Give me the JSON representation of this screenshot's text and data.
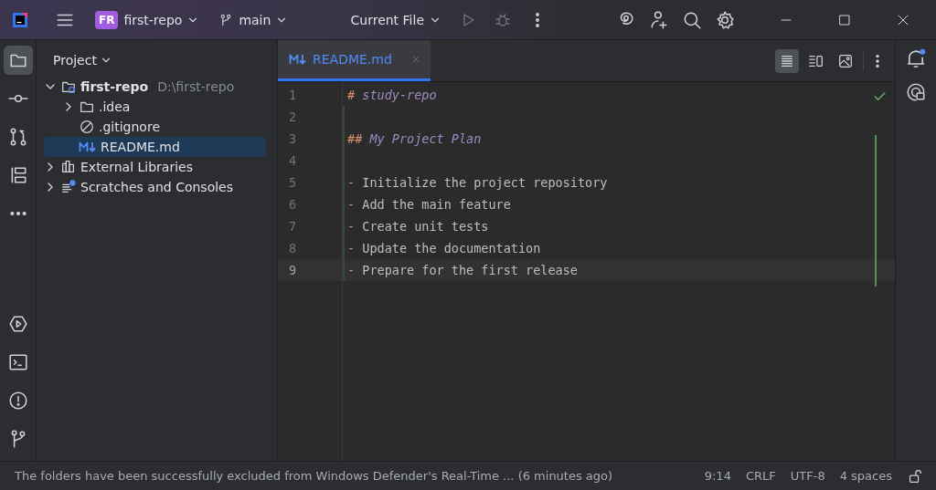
{
  "title_bar": {
    "project_badge": "FR",
    "project": "first-repo",
    "branch": "main",
    "run_config": "Current File"
  },
  "project_panel": {
    "title": "Project",
    "tree": [
      {
        "label": "first-repo",
        "hint": "D:\\first-repo",
        "kind": "module",
        "bold": true,
        "expanded": true,
        "selected": false,
        "children": [
          {
            "label": ".idea",
            "kind": "folder",
            "expanded": false,
            "selected": false
          },
          {
            "label": ".gitignore",
            "kind": "ignore",
            "selected": false
          },
          {
            "label": "README.md",
            "kind": "markdown",
            "selected": true
          }
        ]
      },
      {
        "label": "External Libraries",
        "kind": "library",
        "expanded": false,
        "selected": false
      },
      {
        "label": "Scratches and Consoles",
        "kind": "scratches",
        "expanded": false,
        "selected": false
      }
    ]
  },
  "editor": {
    "tabs": [
      {
        "label": "README.md",
        "selected": true
      }
    ],
    "lines": [
      {
        "number": "1",
        "kind": "heading",
        "marker": "#",
        "text": "study-repo",
        "current": false
      },
      {
        "number": "2",
        "kind": "blank",
        "current": false
      },
      {
        "number": "3",
        "kind": "heading",
        "marker": "##",
        "text": "My Project Plan",
        "current": false
      },
      {
        "number": "4",
        "kind": "blank",
        "current": false
      },
      {
        "number": "5",
        "kind": "bullet",
        "marker": "-",
        "text": "Initialize the project repository",
        "current": false
      },
      {
        "number": "6",
        "kind": "bullet",
        "marker": "-",
        "text": "Add the main feature",
        "current": false
      },
      {
        "number": "7",
        "kind": "bullet",
        "marker": "-",
        "text": "Create unit tests",
        "current": false
      },
      {
        "number": "8",
        "kind": "bullet",
        "marker": "-",
        "text": "Update the documentation",
        "current": false
      },
      {
        "number": "9",
        "kind": "bullet",
        "marker": "-",
        "text": "Prepare for the first release",
        "current": true
      }
    ]
  },
  "status_bar": {
    "message": "The folders have been successfully excluded from Windows Defender's Real-Time ... (6 minutes ago)",
    "position": "9:14",
    "line_ending": "CRLF",
    "encoding": "UTF-8",
    "indent": "4 spaces"
  }
}
